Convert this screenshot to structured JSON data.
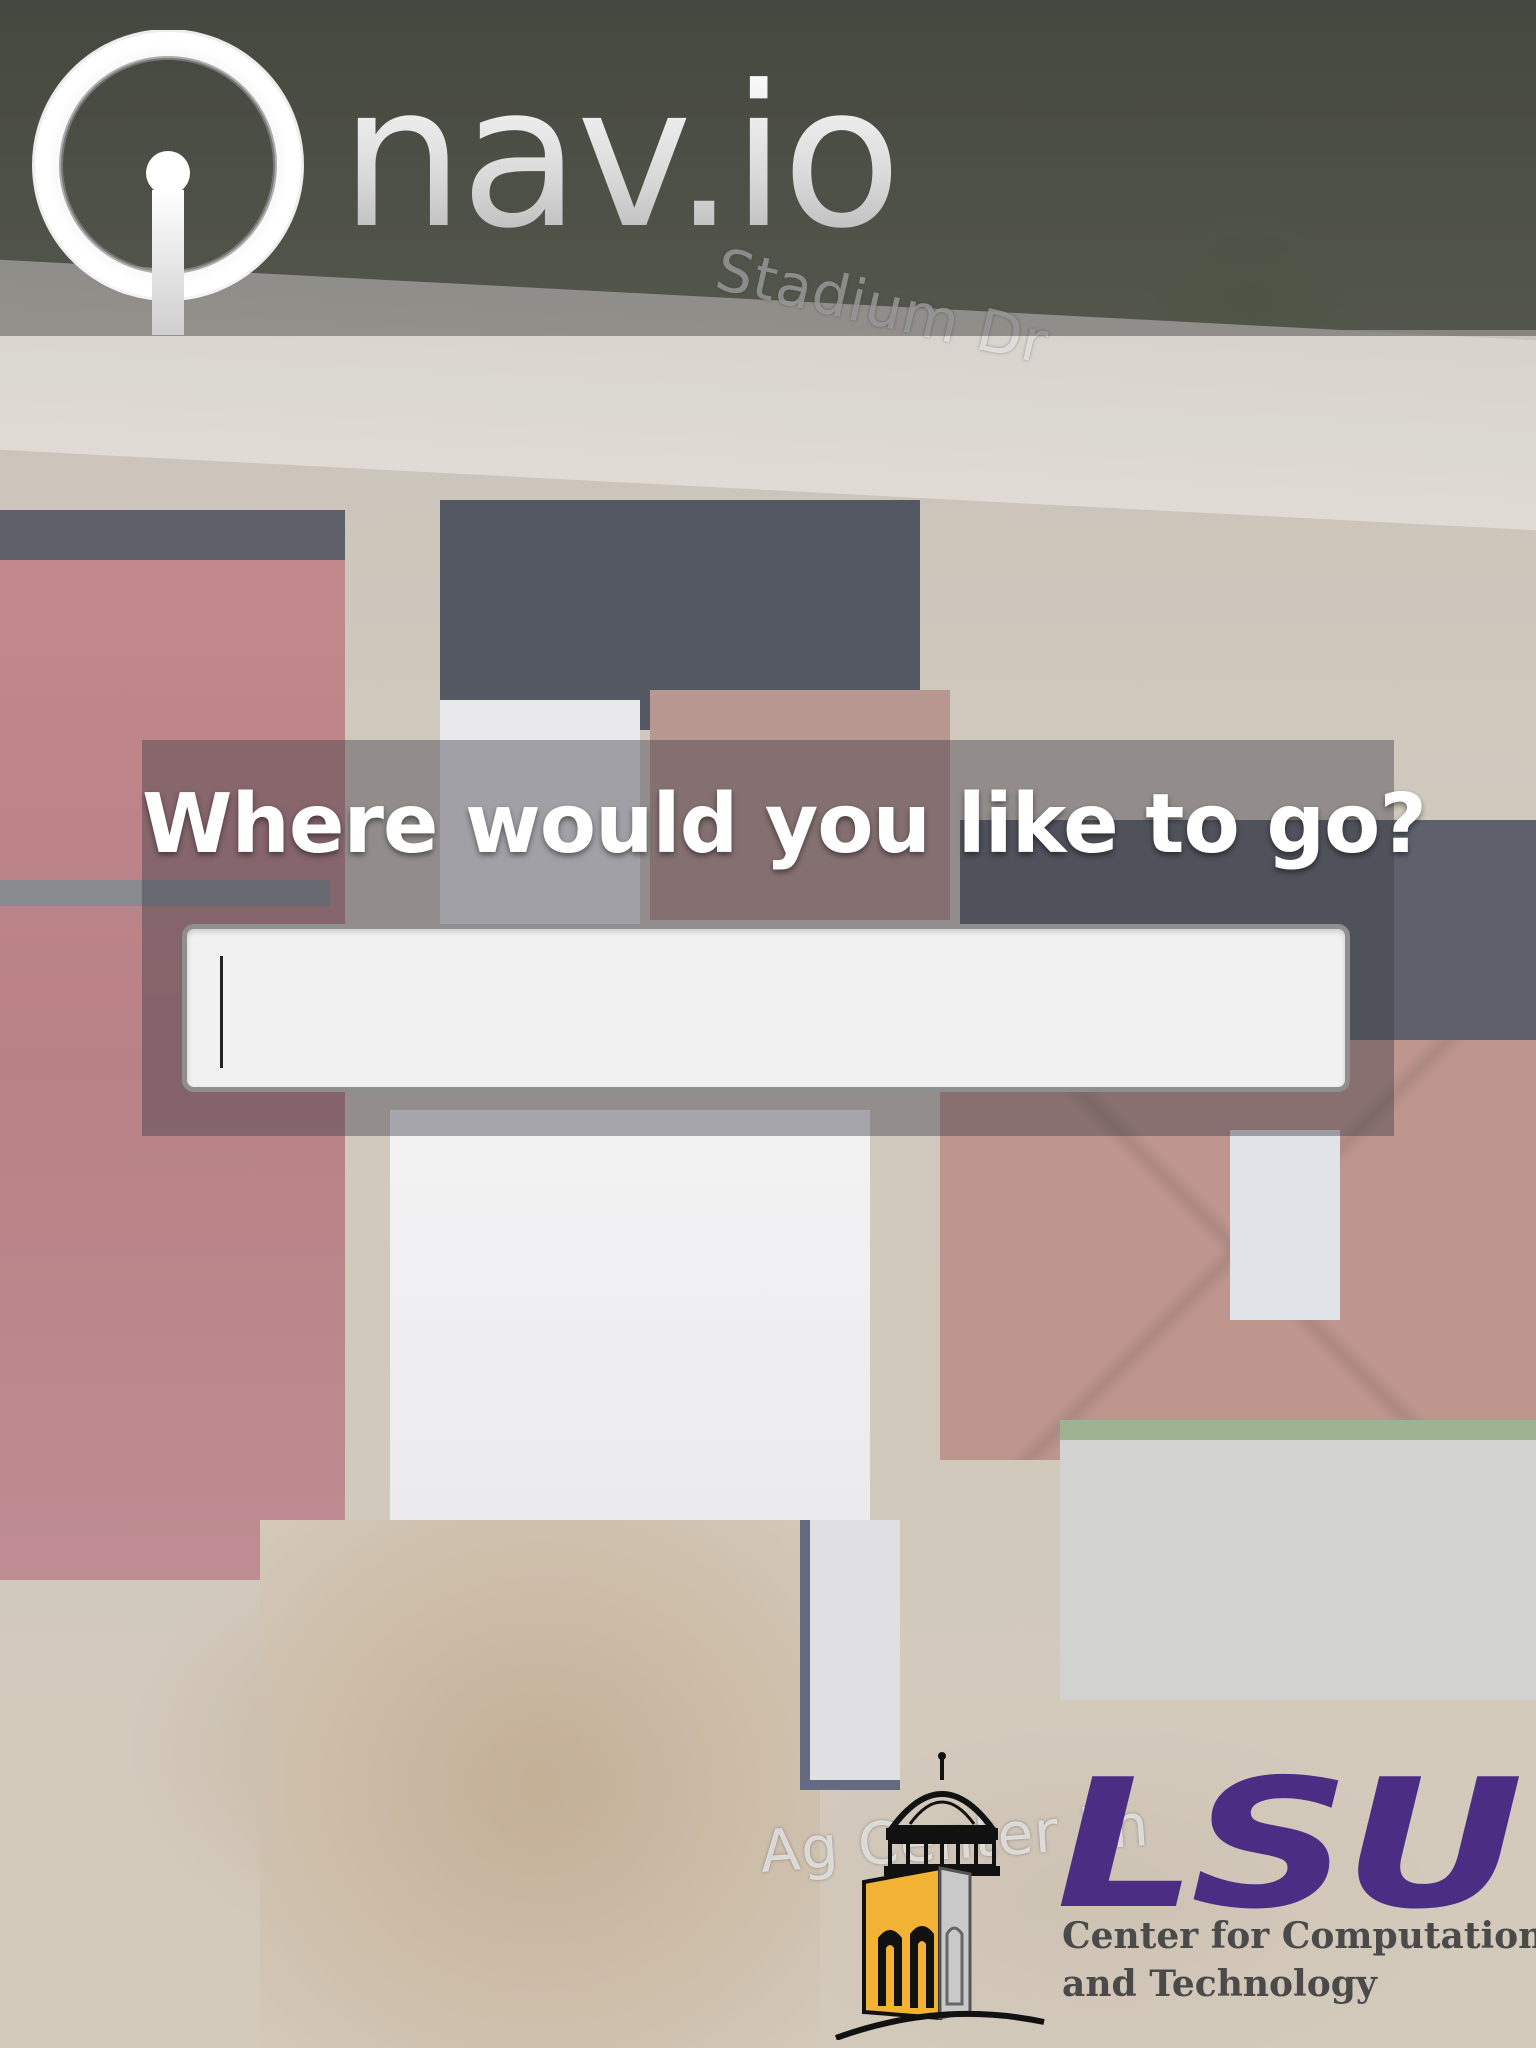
{
  "header": {
    "brand_name": "nav.io"
  },
  "map": {
    "street_labels": [
      "Stadium Dr",
      "Ag Center Ln"
    ]
  },
  "search": {
    "prompt": "Where would you like to go?",
    "value": "",
    "placeholder": ""
  },
  "sponsor": {
    "logo_text": "LSU",
    "line1": "Center for Computation",
    "line2": "and Technology"
  },
  "colors": {
    "lsu_purple": "#4b2e83",
    "lsu_gold": "#f2b233",
    "logo_silver": "#e6e6e6"
  }
}
